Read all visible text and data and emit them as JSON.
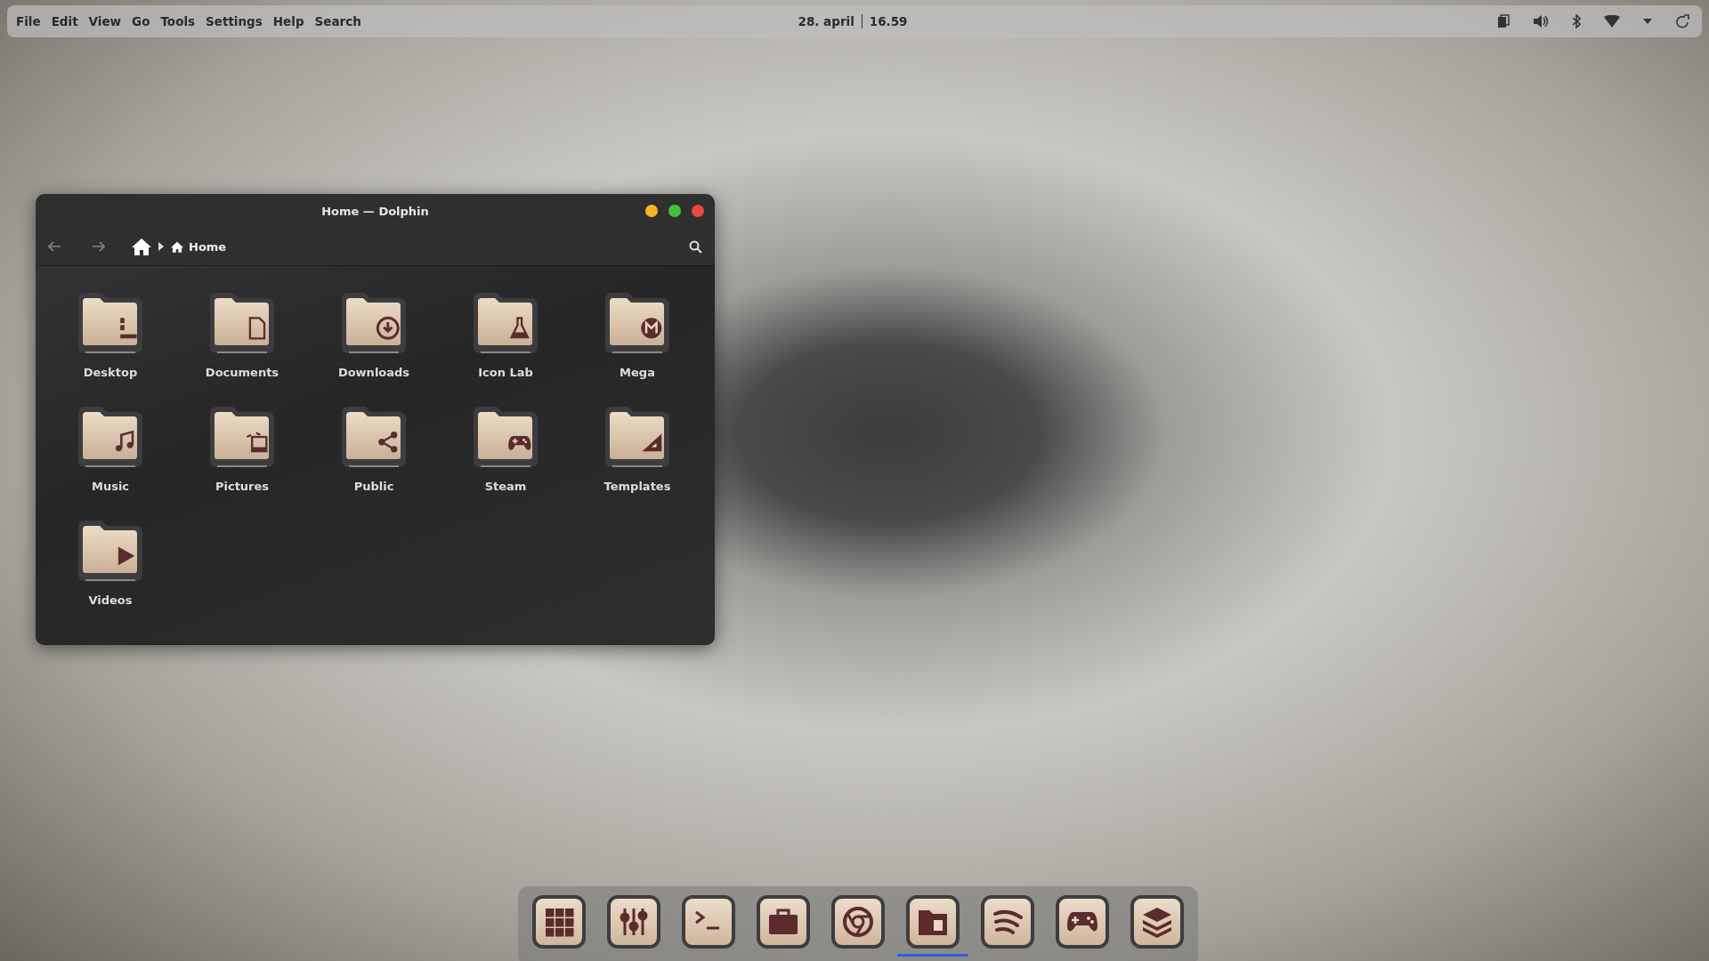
{
  "top_bar": {
    "menu": [
      "File",
      "Edit",
      "View",
      "Go",
      "Tools",
      "Settings",
      "Help",
      "Search"
    ],
    "date": "28. april",
    "time": "16.59"
  },
  "window": {
    "title": "Home — Dolphin",
    "location": "Home",
    "folders": [
      {
        "name": "Desktop",
        "kind": "desktop"
      },
      {
        "name": "Documents",
        "kind": "document"
      },
      {
        "name": "Downloads",
        "kind": "download"
      },
      {
        "name": "Icon Lab",
        "kind": "lab"
      },
      {
        "name": "Mega",
        "kind": "mega"
      },
      {
        "name": "Music",
        "kind": "music"
      },
      {
        "name": "Pictures",
        "kind": "pictures"
      },
      {
        "name": "Public",
        "kind": "share"
      },
      {
        "name": "Steam",
        "kind": "gamepad"
      },
      {
        "name": "Templates",
        "kind": "templates"
      },
      {
        "name": "Videos",
        "kind": "video"
      }
    ]
  },
  "dock": {
    "items": [
      {
        "kind": "apps",
        "selected": false
      },
      {
        "kind": "mixer",
        "selected": false
      },
      {
        "kind": "terminal",
        "selected": false
      },
      {
        "kind": "briefcase",
        "selected": false
      },
      {
        "kind": "browser",
        "selected": false
      },
      {
        "kind": "files",
        "selected": true
      },
      {
        "kind": "stream",
        "selected": false
      },
      {
        "kind": "gamepad",
        "selected": false
      },
      {
        "kind": "layers",
        "selected": false
      }
    ]
  }
}
